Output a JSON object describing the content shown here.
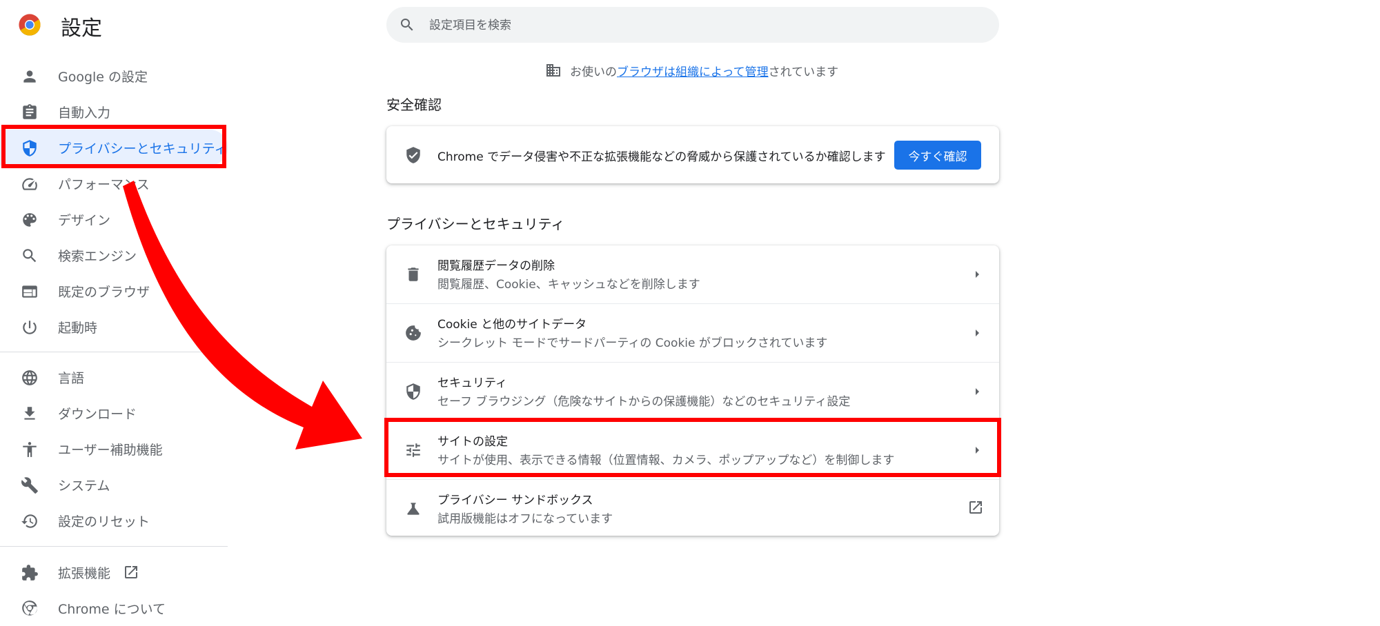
{
  "app": {
    "title": "設定"
  },
  "search": {
    "placeholder": "設定項目を検索"
  },
  "managed_notice": {
    "prefix": "お使いの",
    "link": "ブラウザは組織によって管理",
    "suffix": "されています"
  },
  "sidebar": {
    "items": [
      {
        "label": "Google の設定",
        "icon": "person-icon"
      },
      {
        "label": "自動入力",
        "icon": "clipboard-icon"
      },
      {
        "label": "プライバシーとセキュリティ",
        "icon": "shield-icon",
        "active": true
      },
      {
        "label": "パフォーマンス",
        "icon": "speedometer-icon"
      },
      {
        "label": "デザイン",
        "icon": "palette-icon"
      },
      {
        "label": "検索エンジン",
        "icon": "search-icon"
      },
      {
        "label": "既定のブラウザ",
        "icon": "browser-window-icon"
      },
      {
        "label": "起動時",
        "icon": "power-icon"
      },
      {
        "label": "言語",
        "icon": "globe-icon"
      },
      {
        "label": "ダウンロード",
        "icon": "download-icon"
      },
      {
        "label": "ユーザー補助機能",
        "icon": "accessibility-icon"
      },
      {
        "label": "システム",
        "icon": "wrench-icon"
      },
      {
        "label": "設定のリセット",
        "icon": "restore-icon"
      },
      {
        "label": "拡張機能",
        "icon": "puzzle-icon"
      },
      {
        "label": "Chrome について",
        "icon": "chrome-icon"
      }
    ]
  },
  "safety_check": {
    "title": "安全確認",
    "text": "Chrome でデータ侵害や不正な拡張機能などの脅威から保護されているか確認します",
    "button": "今すぐ確認"
  },
  "privacy": {
    "title": "プライバシーとセキュリティ",
    "rows": [
      {
        "title": "閲覧履歴データの削除",
        "sub": "閲覧履歴、Cookie、キャッシュなどを削除します",
        "icon": "trash-icon"
      },
      {
        "title": "Cookie と他のサイトデータ",
        "sub": "シークレット モードでサードパーティの Cookie がブロックされています",
        "icon": "cookie-icon"
      },
      {
        "title": "セキュリティ",
        "sub": "セーフ ブラウジング（危険なサイトからの保護機能）などのセキュリティ設定",
        "icon": "shield-outline-icon"
      },
      {
        "title": "サイトの設定",
        "sub": "サイトが使用、表示できる情報（位置情報、カメラ、ポップアップなど）を制御します",
        "icon": "tune-sliders-icon"
      },
      {
        "title": "プライバシー サンドボックス",
        "sub": "試用版機能はオフになっています",
        "icon": "flask-icon"
      }
    ]
  },
  "colors": {
    "accent": "#1a73e8",
    "highlight": "#ff0000",
    "text": "#202124",
    "muted": "#5f6368"
  }
}
